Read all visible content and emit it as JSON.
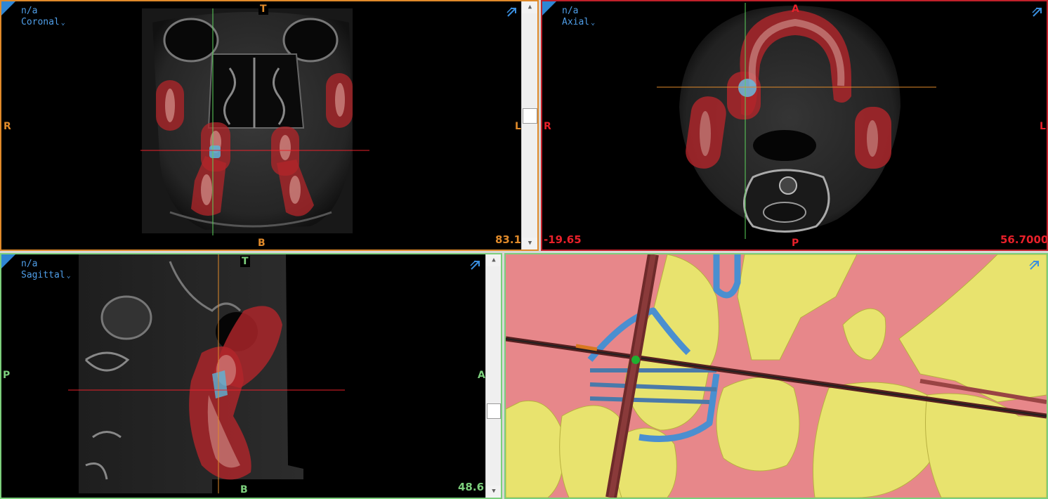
{
  "views": {
    "coronal": {
      "source": "n/a",
      "name": "Coronal",
      "label_top": "T",
      "label_bottom": "B",
      "label_left": "R",
      "label_right": "L",
      "value": "83.1",
      "color": "#e08a2a"
    },
    "axial": {
      "source": "n/a",
      "name": "Axial",
      "label_top": "A",
      "label_bottom": "P",
      "label_left": "R",
      "label_right": "L",
      "value_left": "-19.65",
      "value_right": "56.7000",
      "color": "#e8202a"
    },
    "sagittal": {
      "source": "n/a",
      "name": "Sagittal",
      "label_top": "T",
      "label_bottom": "B",
      "label_left": "P",
      "label_right": "A",
      "value": "48.6",
      "color": "#7ccf7c"
    },
    "render3d": {
      "bg_color": "#e7878a",
      "bone_color": "#e8e36e",
      "nerve_color": "#4a8fd0"
    }
  },
  "icons": {
    "view_menu": "chevron-down-icon",
    "maximize": "maximize-arrow-icon",
    "scroll_up": "triangle-up-icon",
    "scroll_down": "triangle-down-icon"
  }
}
